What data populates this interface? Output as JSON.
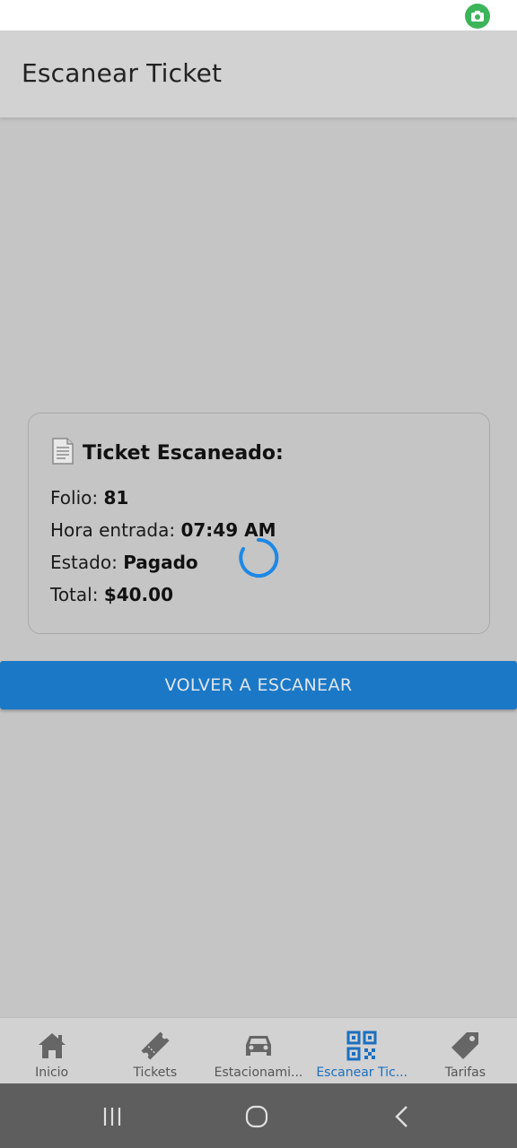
{
  "app_bar": {
    "title": "Escanear Ticket"
  },
  "ticket": {
    "heading": "Ticket Escaneado:",
    "folio_label": "Folio:",
    "folio_value": "81",
    "entry_label": "Hora entrada:",
    "entry_value": "07:49 AM",
    "status_label": "Estado:",
    "status_value": "Pagado",
    "total_label": "Total:",
    "total_value": "$40.00"
  },
  "scan_again_button": "VOLVER A ESCANEAR",
  "tabs": [
    {
      "label": "Inicio",
      "icon": "home-icon",
      "active": false
    },
    {
      "label": "Tickets",
      "icon": "ticket-icon",
      "active": false
    },
    {
      "label": "Estacionami...",
      "icon": "car-icon",
      "active": false
    },
    {
      "label": "Escanear Tic...",
      "icon": "qr-code-icon",
      "active": true
    },
    {
      "label": "Tarifas",
      "icon": "tag-icon",
      "active": false
    }
  ],
  "colors": {
    "accent": "#1b78c6",
    "active_tab": "#1b6fc0",
    "background": "#c5c5c5",
    "app_bar": "#d2d2d2",
    "status_camera": "#3cb55a"
  }
}
